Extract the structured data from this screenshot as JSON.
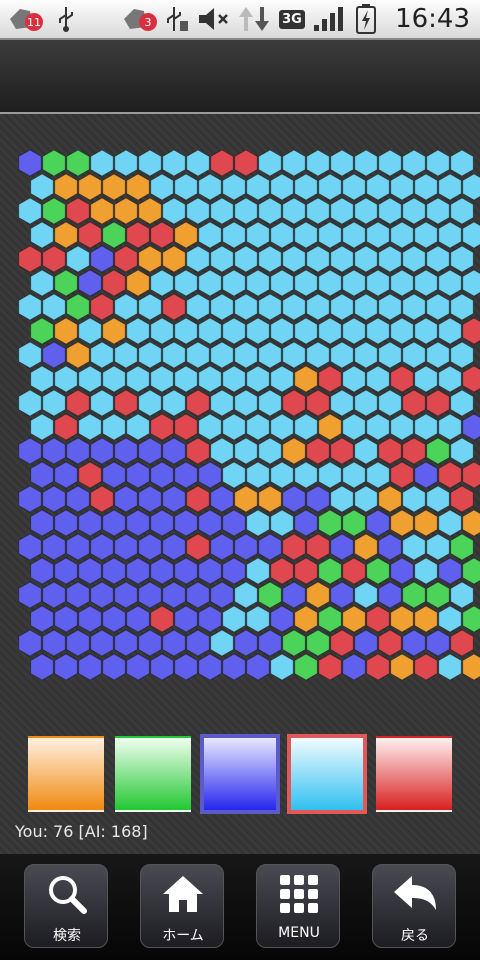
{
  "status_bar": {
    "time": "16:43",
    "notification_badge_1": "11",
    "notification_badge_2": "3",
    "network": "3G",
    "icons": [
      "notification-icon",
      "usb-icon",
      "notification-icon",
      "usb-icon",
      "mute-icon",
      "data-arrows-icon",
      "network-3g-icon",
      "signal-icon",
      "battery-icon"
    ]
  },
  "colors": {
    "orange": "#f0a030",
    "green": "#4cd45a",
    "blue": "#6060ee",
    "cyan": "#70d4f4",
    "red": "#e04850"
  },
  "board": {
    "columns": 19,
    "rows": 22,
    "cells": [
      "BGGCCCCCRRCCCCCCCCC",
      "COOOOCCCCCCCCCCCCCC",
      "CGROOOCCCCCCCCCCCCC",
      "CORGRROCCCCCCCCCCCC",
      "RRCBROOCCCCCCCCCCCC",
      "CGBROCCCCCCCCCCCCCC",
      "CCGRCCRCCCCCCCCCCCC",
      "GOCOCCCCCCCCCCCCCCR",
      "CBOCCCCCCCCCCCCCCCC",
      "CCCCCCCCCCCORCCRCCR",
      "CCRCRCCRCCCRRCCCRRC",
      "CRCCCRRCCCCCOCCCCCB",
      "BBBBBBBRCCCORRCRRGC",
      "BBRBBBBBCCCCCCCRBRR",
      "BBBRBBBRBOOBBCCOCCR",
      "BBBBBBBBBCCBGGBOOCOR",
      "BBBBBBBRBBBRRBOBCCGC",
      "BBBBBBBBBCRRGRGBCBG",
      "BBBBBBBBBCGBOBCBGGCG",
      "BBBBBRBBCCBOGOROOCG",
      "BBBBBBBBCBBGGRBRBBRO",
      "BBBBBBBBBBCGRBRORCOG"
    ]
  },
  "palette": [
    {
      "key": "orange",
      "top": "#fff0e0",
      "bottom": "#f08a10",
      "active": false
    },
    {
      "key": "green",
      "top": "#f0fff0",
      "bottom": "#22c832",
      "active": false
    },
    {
      "key": "blue",
      "top": "#e8e8ff",
      "bottom": "#2626ee",
      "active": true,
      "border": "#5a5ac8"
    },
    {
      "key": "cyan",
      "top": "#f2fcff",
      "bottom": "#30c0f0",
      "active": true,
      "border": "#e05858"
    },
    {
      "key": "red",
      "top": "#fff0f0",
      "bottom": "#d82020",
      "active": false
    }
  ],
  "score": {
    "text": "You: 76 [AI: 168]"
  },
  "nav": {
    "search_label": "検索",
    "home_label": "ホーム",
    "menu_label": "MENU",
    "back_label": "戻る"
  }
}
